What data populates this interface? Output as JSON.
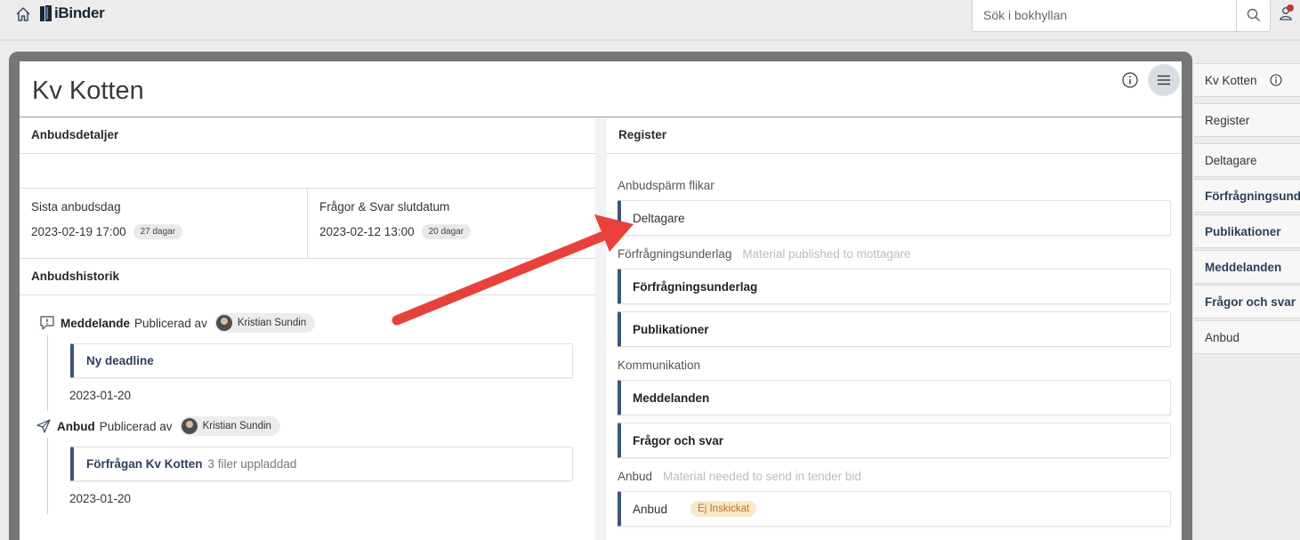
{
  "app": {
    "name": "iBinder"
  },
  "search": {
    "placeholder": "Sök i bokhyllan"
  },
  "page": {
    "title": "Kv Kotten"
  },
  "left": {
    "details_heading": "Anbudsdetaljer",
    "dates": [
      {
        "label": "Sista anbudsdag",
        "value": "2023-02-19 17:00",
        "badge": "27 dagar"
      },
      {
        "label": "Frågor & Svar slutdatum",
        "value": "2023-02-12 13:00",
        "badge": "20 dagar"
      }
    ],
    "history_heading": "Anbudshistorik",
    "history": [
      {
        "type": "Meddelande",
        "action": "Publicerad av",
        "person": "Kristian Sundin",
        "card_title": "Ny deadline",
        "card_note": "",
        "date": "2023-01-20",
        "icon": "message-alert-icon"
      },
      {
        "type": "Anbud",
        "action": "Publicerad av",
        "person": "Kristian Sundin",
        "card_title": "Förfrågan Kv Kotten",
        "card_note": "3 filer uppladdad",
        "date": "2023-01-20",
        "icon": "paper-plane-icon"
      }
    ]
  },
  "right": {
    "register_heading": "Register",
    "groups": [
      {
        "label": "Anbudspärm flikar",
        "hint": "",
        "items": [
          {
            "label": "Deltagare",
            "bold": false
          }
        ]
      },
      {
        "label": "Förfrågningsunderlag",
        "hint": "Material published to mottagare",
        "items": [
          {
            "label": "Förfrågningsunderlag",
            "bold": true
          },
          {
            "label": "Publikationer",
            "bold": true
          }
        ]
      },
      {
        "label": "Kommunikation",
        "hint": "",
        "items": [
          {
            "label": "Meddelanden",
            "bold": true
          },
          {
            "label": "Frågor och svar",
            "bold": true
          }
        ]
      },
      {
        "label": "Anbud",
        "hint": "Material needed to send in tender bid",
        "items": [
          {
            "label": "Anbud",
            "bold": false,
            "status": "Ej Inskickat"
          }
        ]
      }
    ]
  },
  "nav": {
    "items": [
      {
        "label": "Kv Kotten",
        "bold": false,
        "info": true
      },
      {
        "label": "Register",
        "bold": false
      },
      {
        "label": "Deltagare",
        "bold": false
      },
      {
        "label": "Förfrågningsunderlag",
        "bold": true
      },
      {
        "label": "Publikationer",
        "bold": true
      },
      {
        "label": "Meddelanden",
        "bold": true
      },
      {
        "label": "Frågor och svar",
        "bold": true
      },
      {
        "label": "Anbud",
        "bold": false
      }
    ]
  },
  "colors": {
    "accent": "#3e5578",
    "arrow": "#e8413c",
    "status_bg": "#fbe7c9",
    "status_text": "#b0752d",
    "notification": "#c0392b"
  }
}
